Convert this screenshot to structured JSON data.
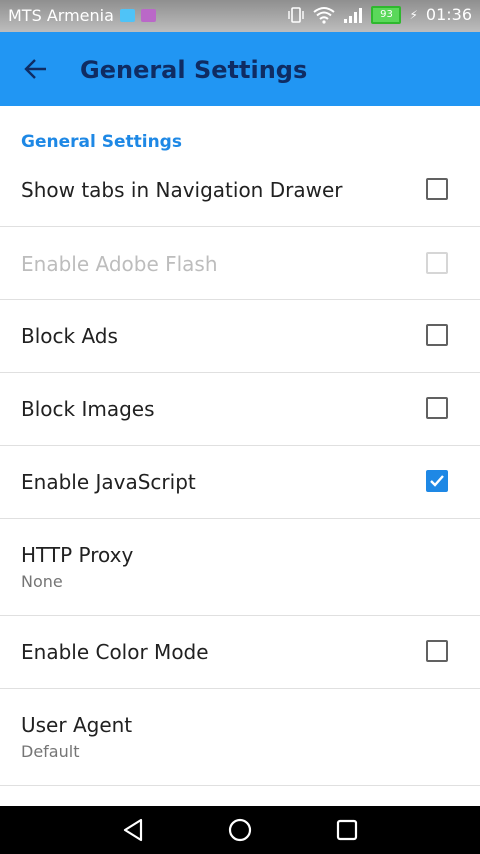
{
  "status_bar": {
    "carrier": "MTS Armenia",
    "battery_level": "93",
    "time": "01:36"
  },
  "app_bar": {
    "title": "General Settings"
  },
  "section": {
    "header": "General Settings"
  },
  "settings": [
    {
      "title": "Show tabs in Navigation Drawer",
      "checked": false,
      "enabled": true
    },
    {
      "title": "Enable Adobe Flash",
      "checked": false,
      "enabled": false
    },
    {
      "title": "Block Ads",
      "checked": false,
      "enabled": true
    },
    {
      "title": "Block Images",
      "checked": false,
      "enabled": true
    },
    {
      "title": "Enable JavaScript",
      "checked": true,
      "enabled": true
    },
    {
      "title": "HTTP Proxy",
      "summary": "None"
    },
    {
      "title": "Enable Color Mode",
      "checked": false,
      "enabled": true
    },
    {
      "title": "User Agent",
      "summary": "Default"
    }
  ],
  "colors": {
    "app_bar": "#2196f3",
    "accent": "#1e88e5",
    "status_bar": "#a8a8a8",
    "nav_bar": "#000000"
  }
}
